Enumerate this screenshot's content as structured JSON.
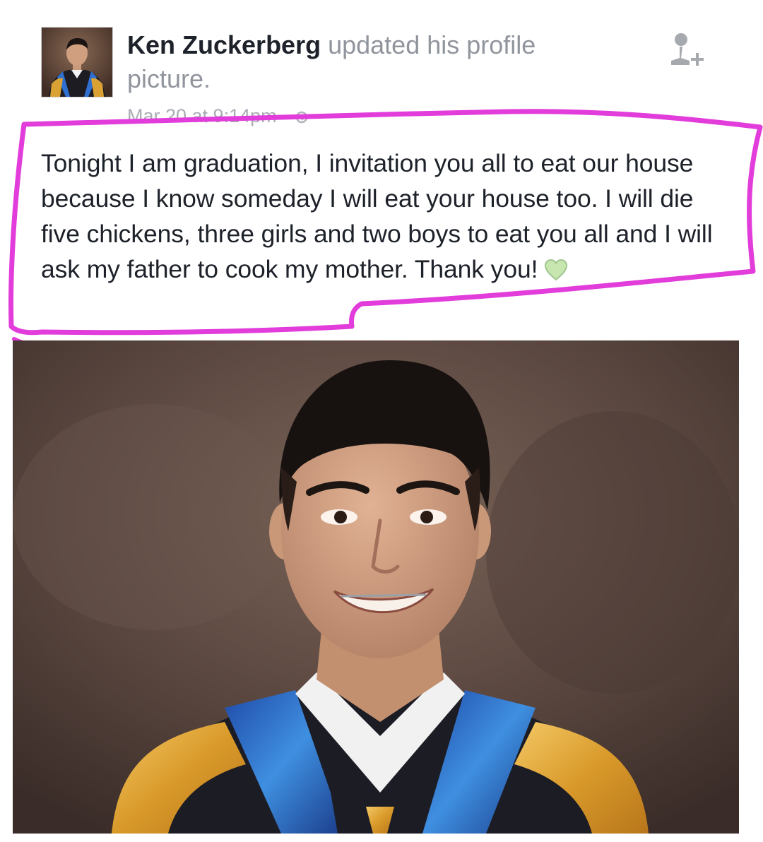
{
  "post": {
    "author": "Ken Zuckerberg",
    "action": "updated his profile picture.",
    "timestamp": "Mar 20 at 9:14pm",
    "meta_separator": "·",
    "privacy_icon": "public-globe-icon",
    "text": "Tonight I am graduation, I invitation you all to eat our house because I know someday I will eat your house too. I will die five chickens, three girls and two boys to eat you all and I will ask my father to cook my mother. Thank you!",
    "emoji_icon": "green-heart-icon",
    "add_friend_icon": "add-friend-icon"
  },
  "colors": {
    "highlight": "#e23ddb",
    "heart": "#c8e7b0",
    "meta_text": "#a8acb3",
    "action_text": "#90949c"
  }
}
